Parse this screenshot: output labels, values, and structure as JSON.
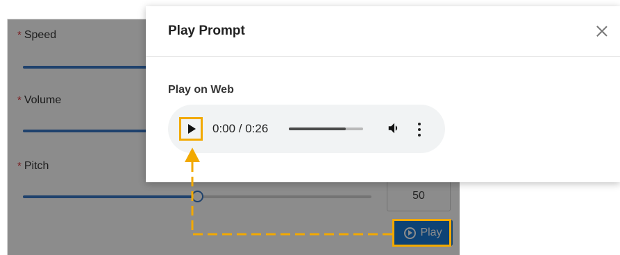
{
  "settings": {
    "speed_label": "Speed",
    "volume_label": "Volume",
    "pitch_label": "Pitch",
    "required_mark": "*",
    "pitch_value": "50",
    "speed_level": 0.36,
    "volume_level": 0.36,
    "pitch_level": 0.5,
    "play_label": "Play"
  },
  "modal": {
    "title": "Play Prompt",
    "section_title": "Play on Web"
  },
  "audio": {
    "time": "0:00 / 0:26",
    "progress": 0.77
  },
  "colors": {
    "accent": "#1a7bd6",
    "highlight": "#f2a900",
    "required": "#e0393e"
  },
  "icons": [
    "close-icon",
    "play-icon",
    "volume-icon",
    "more-options-icon",
    "play-circle-icon",
    "arrow-up-icon"
  ]
}
